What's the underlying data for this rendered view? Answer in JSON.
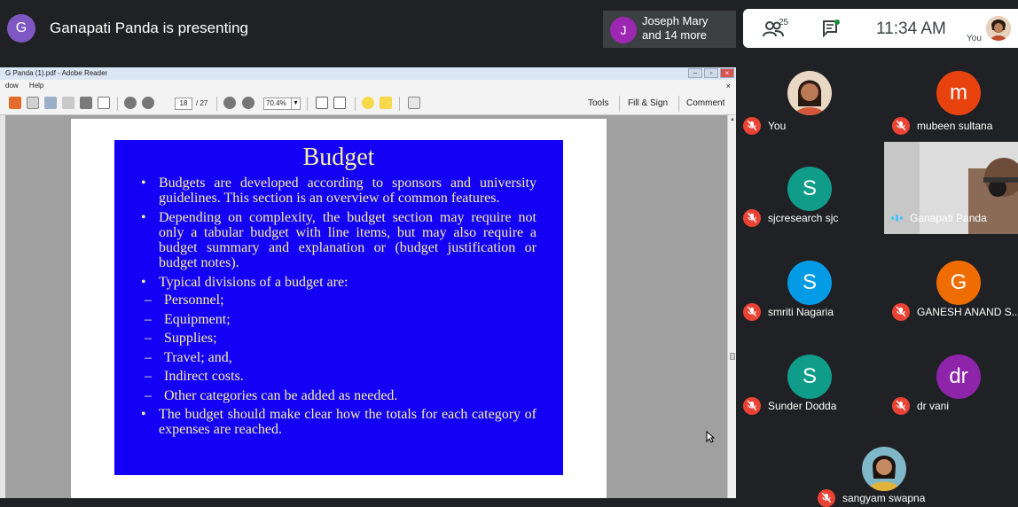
{
  "presenter": {
    "initial": "G",
    "text": "Ganapati Panda is presenting",
    "color": "#7e57c2"
  },
  "joiner": {
    "initial": "J",
    "line1": "Joseph Mary",
    "line2": "and 14 more",
    "color": "#9c27b0"
  },
  "topright": {
    "people_count": "25",
    "time": "11:34 AM",
    "you_label": "You"
  },
  "adobe": {
    "title": "G Panda (1).pdf - Adobe Reader",
    "menu": [
      "dow",
      "Help"
    ],
    "page_current": "18",
    "page_total": "/ 27",
    "zoom": "70.4%",
    "tools": "Tools",
    "fill_sign": "Fill & Sign",
    "comment": "Comment",
    "menu_close": "×"
  },
  "slide": {
    "title": "Budget",
    "bullets": [
      "Budgets are developed according to sponsors and university guidelines.  This section is an overview of common features.",
      "Depending on complexity, the budget section may require not only a tabular budget with line items, but may also require a budget summary and explanation or (budget justification or budget notes).",
      "Typical divisions of a budget are:"
    ],
    "subitems": [
      "Personnel;",
      "Equipment;",
      "Supplies;",
      "Travel; and,",
      "Indirect costs.",
      "Other categories can be added as needed."
    ],
    "last_bullet": "The budget should make clear how the totals for each category of expenses are reached."
  },
  "participants": [
    {
      "name": "You",
      "initial": "",
      "color": "#c99a72",
      "muted": true
    },
    {
      "name": "mubeen sultana",
      "initial": "m",
      "color": "#e8430f",
      "muted": true
    },
    {
      "name": "sjcresearch sjc",
      "initial": "S",
      "color": "#0f9d8a",
      "muted": true
    },
    {
      "name": "Ganapati Panda",
      "initial": "",
      "color": "#d8d8d8",
      "muted": false
    },
    {
      "name": "smriti Nagaria",
      "initial": "S",
      "color": "#039be5",
      "muted": true
    },
    {
      "name": "GANESH ANAND S..",
      "initial": "G",
      "color": "#ef6c00",
      "muted": true
    },
    {
      "name": "Sunder Dodda",
      "initial": "S",
      "color": "#0f9d8a",
      "muted": true
    },
    {
      "name": "dr vani",
      "initial": "dr",
      "color": "#8e24aa",
      "muted": true
    },
    {
      "name": "sangyam swapna",
      "initial": "",
      "color": "#7fb7c9",
      "muted": true
    }
  ]
}
